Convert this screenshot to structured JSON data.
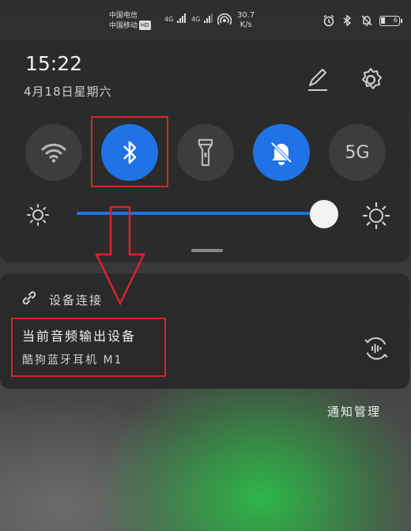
{
  "status_bar": {
    "carrier1": "中国电信",
    "carrier2": "中国移动",
    "hd": "HD",
    "net1": "4G",
    "net2": "4G",
    "speed_value": "30.7",
    "speed_unit": "K/s",
    "battery": "6"
  },
  "quick_settings": {
    "time": "15:22",
    "date": "4月18日星期六",
    "tiles": [
      {
        "name": "wifi",
        "icon": "wifi-icon",
        "active": false
      },
      {
        "name": "bluetooth",
        "icon": "bluetooth-icon",
        "active": true
      },
      {
        "name": "flashlight",
        "icon": "flashlight-icon",
        "active": false
      },
      {
        "name": "do-not-disturb",
        "icon": "bell-off-icon",
        "active": true
      },
      {
        "name": "5g",
        "label": "5G",
        "active": false
      }
    ],
    "brightness_level": 0.95
  },
  "device_connection": {
    "title": "设备连接",
    "current_output_label": "当前音频输出设备",
    "device_name": "酷狗蓝牙耳机 M1"
  },
  "notification_management": "通知管理",
  "colors": {
    "accent": "#1f73e6",
    "annotation": "#d8242c",
    "panel": "#2b2b2b"
  }
}
